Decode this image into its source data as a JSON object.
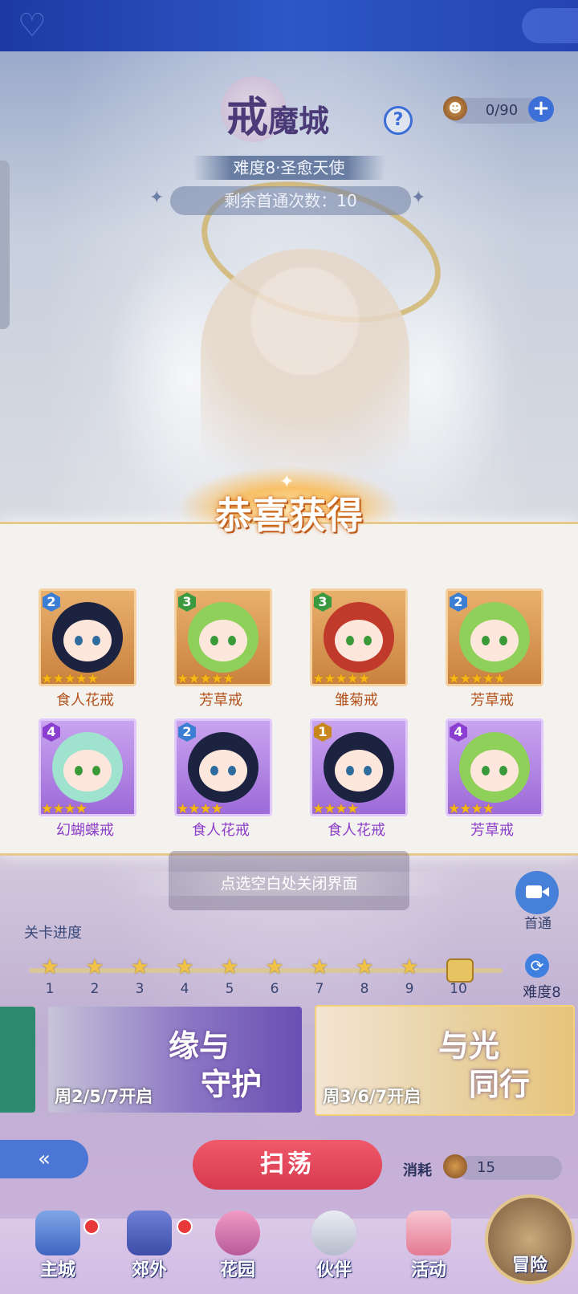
{
  "header": {
    "title_big": "戒",
    "title_small": "魔城",
    "difficulty_banner": "难度8·圣愈天使",
    "remaining_clears": "剩余首通次数：10",
    "resource_count": "0/90"
  },
  "popup": {
    "title": "恭喜获得",
    "rewards": [
      {
        "name": "食人花戒",
        "level": "2",
        "stars": "★★★★★",
        "rarity": "orange"
      },
      {
        "name": "芳草戒",
        "level": "3",
        "stars": "★★★★★",
        "rarity": "orange"
      },
      {
        "name": "雏菊戒",
        "level": "3",
        "stars": "★★★★★",
        "rarity": "orange"
      },
      {
        "name": "芳草戒",
        "level": "2",
        "stars": "★★★★★",
        "rarity": "orange"
      },
      {
        "name": "幻蝴蝶戒",
        "level": "4",
        "stars": "★★★★",
        "rarity": "purple"
      },
      {
        "name": "食人花戒",
        "level": "2",
        "stars": "★★★★",
        "rarity": "purple"
      },
      {
        "name": "食人花戒",
        "level": "1",
        "stars": "★★★★",
        "rarity": "purple"
      },
      {
        "name": "芳草戒",
        "level": "4",
        "stars": "★★★★",
        "rarity": "purple"
      }
    ],
    "close_hint": "点选空白处关闭界面"
  },
  "record": {
    "label": "首通"
  },
  "progress": {
    "title": "关卡进度",
    "stages": [
      "1",
      "2",
      "3",
      "4",
      "5",
      "6",
      "7",
      "8",
      "9",
      "10"
    ],
    "difficulty_label": "难度8"
  },
  "events": {
    "event1": {
      "title_line1": "缘与",
      "title_line2": "守护",
      "schedule": "周2/5/7开启"
    },
    "event2": {
      "title_line1": "与光",
      "title_line2": "同行",
      "schedule": "周3/6/7开启"
    }
  },
  "actions": {
    "sweep": "扫荡",
    "cost_label": "消耗",
    "cost_value": "15"
  },
  "nav": {
    "main_city": "主城",
    "suburbs": "郊外",
    "garden": "花园",
    "partner": "伙伴",
    "activity": "活动",
    "adventure": "冒险"
  },
  "colors": {
    "accent_blue": "#3d6fd8",
    "sweep_red": "#e04a5c",
    "reward_orange_name": "#b4531c",
    "reward_purple_name": "#8e3fc9",
    "star_gold": "#f7b814"
  }
}
